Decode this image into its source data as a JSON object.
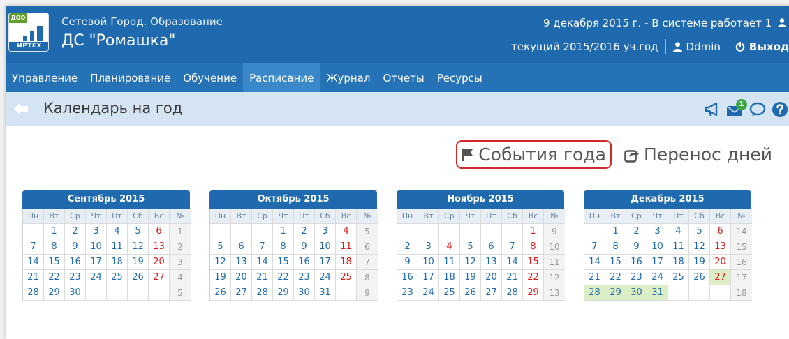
{
  "header": {
    "logo": {
      "tag": "ДОО",
      "brand": "ИРТЕХ"
    },
    "subtitle": "Сетевой Город. Образование",
    "title": "ДС \"Ромашка\"",
    "status": "9 декабря 2015 г. - В системе работает 1",
    "year": "текущий 2015/2016 уч.год",
    "user": "Ddmin",
    "logout": "Выход"
  },
  "nav": [
    "Управление",
    "Планирование",
    "Обучение",
    "Расписание",
    "Журнал",
    "Отчеты",
    "Ресурсы"
  ],
  "nav_active": "Расписание",
  "page": {
    "title": "Календарь на год",
    "messages_badge": "1"
  },
  "actions": {
    "events": "События года",
    "transfer": "Перенос дней"
  },
  "colors": {
    "brand": "#1f6aaf",
    "weekend": "#e01818",
    "holiday": "#dcefc4",
    "highlight": "#d62828"
  },
  "weekdays": [
    "Пн",
    "Вт",
    "Ср",
    "Чт",
    "Пт",
    "Сб",
    "Вс",
    "№"
  ],
  "calendars": [
    {
      "title": "Сентябрь 2015",
      "weeks": [
        {
          "days": [
            "",
            "1",
            "2",
            "3",
            "4",
            "5",
            "6"
          ],
          "num": "1"
        },
        {
          "days": [
            "7",
            "8",
            "9",
            "10",
            "11",
            "12",
            "13"
          ],
          "num": "2"
        },
        {
          "days": [
            "14",
            "15",
            "16",
            "17",
            "18",
            "19",
            "20"
          ],
          "num": "3"
        },
        {
          "days": [
            "21",
            "22",
            "23",
            "24",
            "25",
            "26",
            "27"
          ],
          "num": "4"
        },
        {
          "days": [
            "28",
            "29",
            "30",
            "",
            "",
            "",
            ""
          ],
          "num": "5"
        }
      ]
    },
    {
      "title": "Октябрь 2015",
      "weeks": [
        {
          "days": [
            "",
            "",
            "",
            "1",
            "2",
            "3",
            "4"
          ],
          "num": "5"
        },
        {
          "days": [
            "5",
            "6",
            "7",
            "8",
            "9",
            "10",
            "11"
          ],
          "num": "6"
        },
        {
          "days": [
            "12",
            "13",
            "14",
            "15",
            "16",
            "17",
            "18"
          ],
          "num": "7"
        },
        {
          "days": [
            "19",
            "20",
            "21",
            "22",
            "23",
            "24",
            "25"
          ],
          "num": "8"
        },
        {
          "days": [
            "26",
            "27",
            "28",
            "29",
            "30",
            "31",
            ""
          ],
          "num": "9"
        }
      ]
    },
    {
      "title": "Ноябрь 2015",
      "weeks": [
        {
          "days": [
            "",
            "",
            "",
            "",
            "",
            "",
            "1"
          ],
          "num": "9"
        },
        {
          "days": [
            "2",
            "3",
            "4",
            "5",
            "6",
            "7",
            "8"
          ],
          "num": "10",
          "red": [
            "4"
          ]
        },
        {
          "days": [
            "9",
            "10",
            "11",
            "12",
            "13",
            "14",
            "15"
          ],
          "num": "11"
        },
        {
          "days": [
            "16",
            "17",
            "18",
            "19",
            "20",
            "21",
            "22"
          ],
          "num": "12"
        },
        {
          "days": [
            "23",
            "24",
            "25",
            "26",
            "27",
            "28",
            "29"
          ],
          "num": "13"
        }
      ]
    },
    {
      "title": "Декабрь 2015",
      "weeks": [
        {
          "days": [
            "",
            "1",
            "2",
            "3",
            "4",
            "5",
            "6"
          ],
          "num": "14"
        },
        {
          "days": [
            "7",
            "8",
            "9",
            "10",
            "11",
            "12",
            "13"
          ],
          "num": "15"
        },
        {
          "days": [
            "14",
            "15",
            "16",
            "17",
            "18",
            "19",
            "20"
          ],
          "num": "16"
        },
        {
          "days": [
            "21",
            "22",
            "23",
            "24",
            "25",
            "26",
            "27"
          ],
          "num": "17",
          "holiday": [
            "27"
          ]
        },
        {
          "days": [
            "28",
            "29",
            "30",
            "31",
            "",
            "",
            ""
          ],
          "num": "18",
          "holiday": [
            "28",
            "29",
            "30",
            "31"
          ]
        }
      ]
    }
  ]
}
